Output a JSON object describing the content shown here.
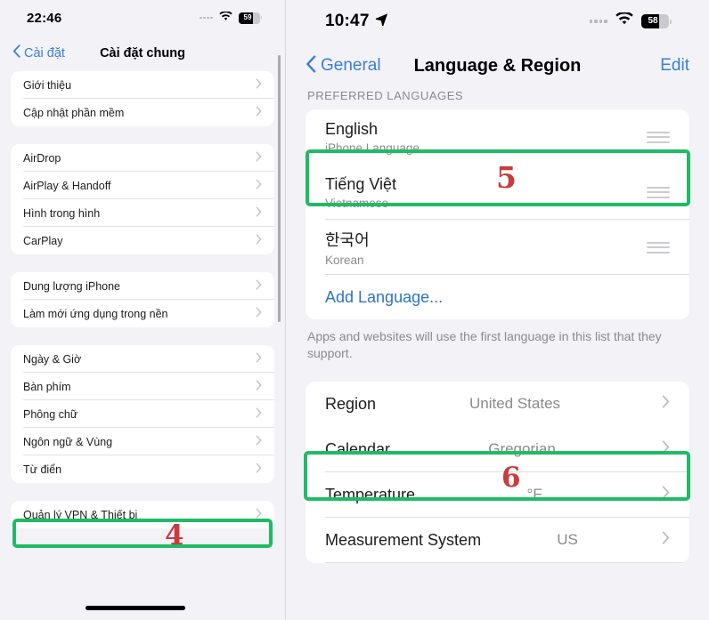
{
  "left_phone": {
    "status": {
      "time": "22:46",
      "battery_percent": "59",
      "wifi_icon": "wifi-icon",
      "dots_icon": "signal-dots-icon"
    },
    "nav": {
      "back_label": "Cài đặt",
      "title": "Cài đặt chung",
      "back_icon": "chevron-left-icon"
    },
    "groups": [
      {
        "rows": [
          {
            "label": "Giới thiệu"
          },
          {
            "label": "Cập nhật phần mềm"
          }
        ]
      },
      {
        "rows": [
          {
            "label": "AirDrop"
          },
          {
            "label": "AirPlay & Handoff"
          },
          {
            "label": "Hình trong hình"
          },
          {
            "label": "CarPlay"
          }
        ]
      },
      {
        "rows": [
          {
            "label": "Dung lượng iPhone"
          },
          {
            "label": "Làm mới ứng dụng trong nền"
          }
        ]
      },
      {
        "rows": [
          {
            "label": "Ngày & Giờ"
          },
          {
            "label": "Bàn phím"
          },
          {
            "label": "Phông chữ"
          },
          {
            "label": "Ngôn ngữ & Vùng"
          },
          {
            "label": "Từ điển"
          }
        ]
      },
      {
        "rows": [
          {
            "label": "Quản lý VPN & Thiết bị"
          }
        ]
      }
    ],
    "callout": {
      "number": "4"
    }
  },
  "right_phone": {
    "status": {
      "time": "10:47",
      "battery_percent": "58",
      "location_icon": "location-arrow-icon",
      "wifi_icon": "wifi-icon",
      "dots_icon": "signal-dots-icon"
    },
    "nav": {
      "back_label": "General",
      "title": "Language & Region",
      "action_label": "Edit",
      "back_icon": "chevron-left-icon"
    },
    "section_header": "PREFERRED LANGUAGES",
    "languages": [
      {
        "name": "English",
        "sub": "iPhone Language",
        "handle_icon": "drag-handle-icon"
      },
      {
        "name": "Tiếng Việt",
        "sub": "Vietnamese",
        "handle_icon": "drag-handle-icon"
      },
      {
        "name": "한국어",
        "sub": "Korean",
        "handle_icon": "drag-handle-icon"
      }
    ],
    "add_language_label": "Add Language...",
    "footnote": "Apps and websites will use the first language in this list that they support.",
    "region_rows": [
      {
        "label": "Region",
        "value": "United States"
      },
      {
        "label": "Calendar",
        "value": "Gregorian"
      },
      {
        "label": "Temperature",
        "value": "°F"
      },
      {
        "label": "Measurement System",
        "value": "US"
      }
    ],
    "callouts": {
      "language": "5",
      "region": "6"
    }
  },
  "colors": {
    "highlight_green": "#1fbb66",
    "callout_red": "#cc3b3b",
    "link_blue": "#2f73c8",
    "nav_blue": "#3a7fd5"
  }
}
